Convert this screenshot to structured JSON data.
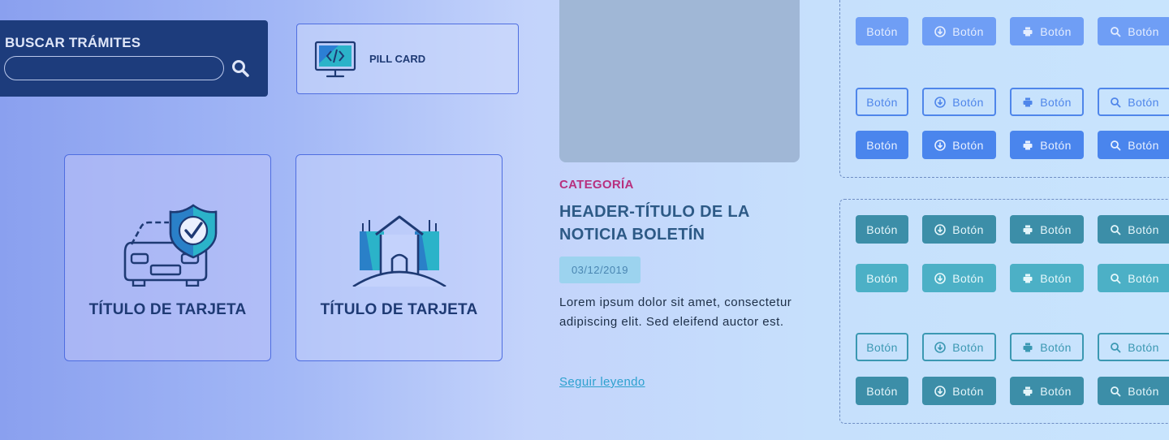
{
  "search": {
    "title": "BUSCAR TRÁMITES",
    "placeholder": ""
  },
  "pill_card": {
    "label": "PILL CARD",
    "icon": "monitor-code-icon"
  },
  "cards": [
    {
      "title": "TÍTULO DE TARJETA",
      "icon": "car-shield-icon"
    },
    {
      "title": "TÍTULO DE TARJETA",
      "icon": "house-buildings-icon"
    }
  ],
  "news": {
    "category": "CATEGORÍA",
    "headline": "HEADER-TÍTULO DE LA NOTICIA BOLETÍN",
    "date": "03/12/2019",
    "body": "Lorem ipsum dolor sit amet, consectetur adipiscing elit. Sed eleifend auctor est.",
    "link": "Seguir leyendo"
  },
  "buttons": {
    "label": "Botón",
    "icons": [
      "none",
      "download-icon",
      "print-icon",
      "search-icon"
    ]
  },
  "colors": {
    "search_bg": "#1d3c7c",
    "category": "#b8307e",
    "headline": "#2d5a86",
    "link": "#2da1cf",
    "blue_button": "#4a85ed",
    "teal_button": "#3c8ea8"
  }
}
